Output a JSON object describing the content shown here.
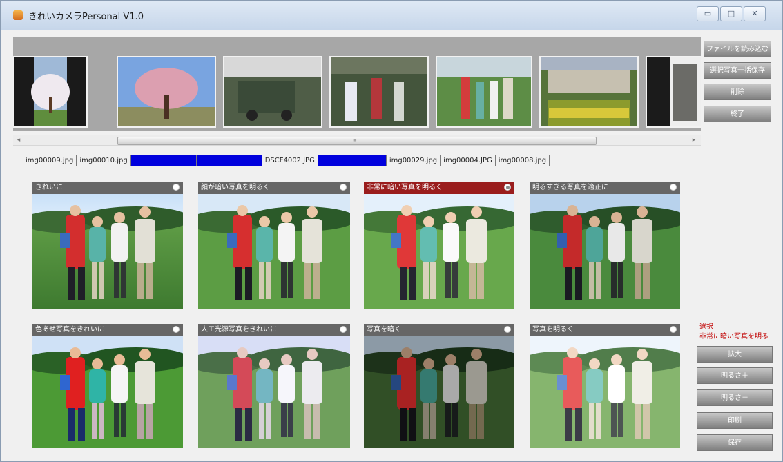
{
  "window": {
    "title": "きれいカメラPersonal  V1.0",
    "controls": [
      "▭",
      "□",
      "✕"
    ]
  },
  "strip": {
    "thumbnails": [
      "cherry-blossom-tree",
      "pink-blossom-tree",
      "golf-cart",
      "golfers-group",
      "four-golfers",
      "palace-garden",
      "church"
    ]
  },
  "scroll": {
    "left": "◂",
    "right": "▸",
    "grip": "≡"
  },
  "right_buttons": [
    "ファイルを読み込む",
    "選択写真一括保存",
    "削除",
    "終了"
  ],
  "tabs": [
    {
      "label": "img00009.jpg",
      "highlight": false
    },
    {
      "label": "img00010.jpg",
      "highlight": false
    },
    {
      "label": "",
      "highlight": true
    },
    {
      "label": "",
      "highlight": true
    },
    {
      "label": "DSCF4002.JPG",
      "highlight": false
    },
    {
      "label": "",
      "highlight": true
    },
    {
      "label": "img00029.jpg",
      "highlight": false
    },
    {
      "label": "img00004.JPG",
      "highlight": false
    },
    {
      "label": "img00008.jpg",
      "highlight": false
    }
  ],
  "cells": [
    {
      "title": "きれいに",
      "selected": false,
      "tone": "normal"
    },
    {
      "title": "顔が暗い写真を明るく",
      "selected": false,
      "tone": "normal"
    },
    {
      "title": "非常に暗い写真を明るく",
      "selected": true,
      "tone": "normal"
    },
    {
      "title": "明るすぎる写真を適正に",
      "selected": false,
      "tone": "cool"
    },
    {
      "title": "色あせ写真をきれいに",
      "selected": false,
      "tone": "vivid"
    },
    {
      "title": "人工光源写真をきれいに",
      "selected": false,
      "tone": "pale"
    },
    {
      "title": "写真を暗く",
      "selected": false,
      "tone": "dark"
    },
    {
      "title": "写真を明るく",
      "selected": false,
      "tone": "light"
    }
  ],
  "selection": {
    "heading": "選択",
    "name": "非常に暗い写真を明る"
  },
  "action_buttons": [
    "拡大",
    "明るさ＋",
    "明るさ－",
    "印刷",
    "保存"
  ]
}
